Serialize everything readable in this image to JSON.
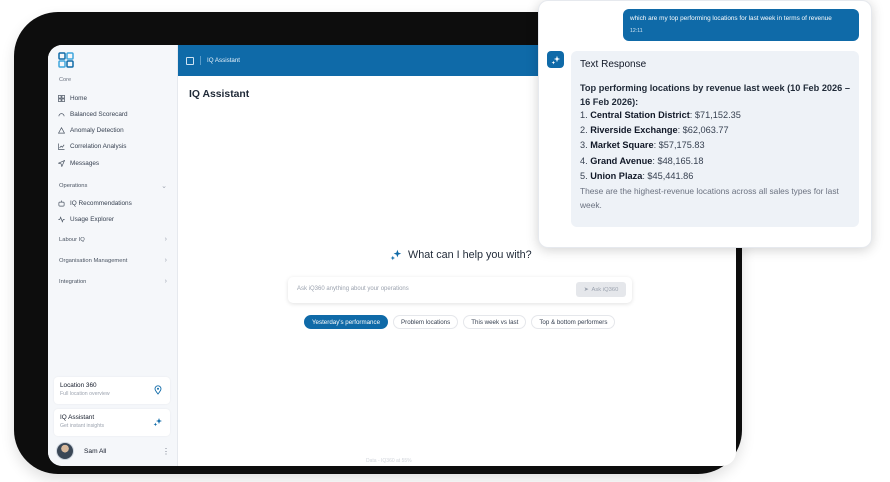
{
  "app": {
    "header_title": "IQ Assistant",
    "page_title": "IQ Assistant",
    "brand_color": "#0f6aa8"
  },
  "sidebar": {
    "core_label": "Core",
    "core_items": [
      {
        "label": "Home",
        "icon": "grid-icon"
      },
      {
        "label": "Balanced Scorecard",
        "icon": "gauge-icon"
      },
      {
        "label": "Anomaly Detection",
        "icon": "warning-icon"
      },
      {
        "label": "Correlation Analysis",
        "icon": "chart-icon"
      },
      {
        "label": "Messages",
        "icon": "send-icon"
      }
    ],
    "operations_label": "Operations",
    "operations_items": [
      {
        "label": "IQ Recommendations",
        "icon": "bot-icon"
      },
      {
        "label": "Usage Explorer",
        "icon": "activity-icon"
      }
    ],
    "groups": [
      "Labour IQ",
      "Organisation Management",
      "Integration"
    ],
    "cards": [
      {
        "title": "Location 360",
        "subtitle": "Full location overview"
      },
      {
        "title": "IQ Assistant",
        "subtitle": "Get instant insights"
      }
    ],
    "user_name": "Sam All"
  },
  "main": {
    "prompt_heading": "What can I help you with?",
    "input_placeholder": "Ask iQ360 anything about your operations",
    "ask_button": "Ask iQ360",
    "chips": [
      "Yesterday's performance",
      "Problem locations",
      "This week vs last",
      "Top & bottom performers"
    ],
    "footer_note": "Data - IQ360 at 55%"
  },
  "chat": {
    "user_message": "which are my top performing locations for last week in terms of revenue",
    "user_time": "12:11",
    "response_title": "Text Response",
    "response_heading": "Top performing locations by revenue last week (10 Feb 2026 – 16 Feb 2026):",
    "results": [
      {
        "rank": "1.",
        "name": "Central Station District",
        "value": ": $71,152.35"
      },
      {
        "rank": "2.",
        "name": "Riverside Exchange",
        "value": ": $62,063.77"
      },
      {
        "rank": "3.",
        "name": "Market Square",
        "value": ": $57,175.83"
      },
      {
        "rank": "4.",
        "name": "Grand Avenue",
        "value": ": $48,165.18"
      },
      {
        "rank": "5.",
        "name": "Union Plaza",
        "value": ": $45,441.86"
      }
    ],
    "response_footer": "These are the highest-revenue locations across all sales types for last week."
  }
}
